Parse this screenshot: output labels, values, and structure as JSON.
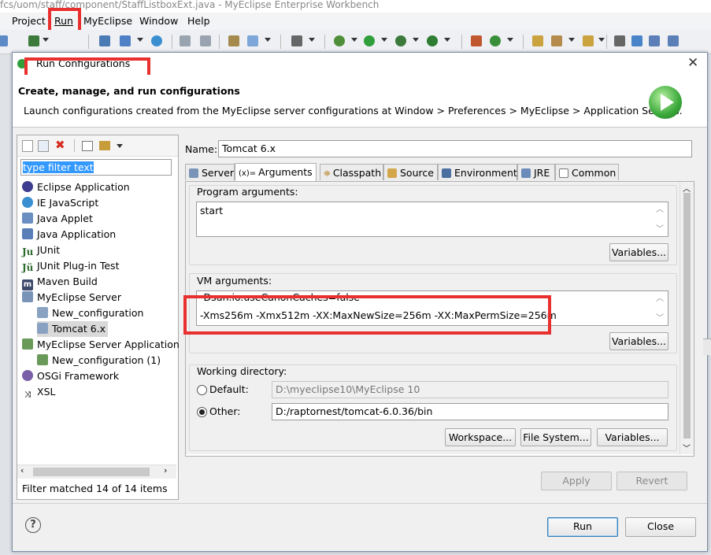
{
  "window": {
    "title": "fcs/uom/staff/component/StaffListboxExt.java - MyEclipse Enterprise Workbench"
  },
  "menubar": {
    "items": [
      "Project",
      "Run",
      "MyEclipse",
      "Window",
      "Help"
    ]
  },
  "dialog": {
    "title": "Run Configurations",
    "header_title": "Create, manage, and run configurations",
    "header_desc": "Launch configurations created from the MyEclipse server configurations at Window > Preferences > MyEclipse > Application Servers."
  },
  "filter": {
    "placeholder": "type filter text",
    "status": "Filter matched 14 of 14 items"
  },
  "tree": [
    {
      "label": "Eclipse Application",
      "icon": "eclipse-icon"
    },
    {
      "label": "IE JavaScript",
      "icon": "globe-icon"
    },
    {
      "label": "Java Applet",
      "icon": "applet-icon"
    },
    {
      "label": "Java Application",
      "icon": "java-app-icon"
    },
    {
      "label": "JUnit",
      "icon": "junit-icon"
    },
    {
      "label": "JUnit Plug-in Test",
      "icon": "junit-plugin-icon"
    },
    {
      "label": "Maven Build",
      "icon": "maven-icon"
    },
    {
      "label": "MyEclipse Server",
      "icon": "server-icon"
    },
    {
      "label": "New_configuration",
      "icon": "server-config-icon"
    },
    {
      "label": "Tomcat  6.x",
      "icon": "server-config-icon"
    },
    {
      "label": "MyEclipse Server Application",
      "icon": "server-app-icon"
    },
    {
      "label": "New_configuration (1)",
      "icon": "server-config-icon"
    },
    {
      "label": "OSGi Framework",
      "icon": "osgi-icon"
    },
    {
      "label": "XSL",
      "icon": "xsl-icon"
    }
  ],
  "config": {
    "name_label": "Name:",
    "name_value": "Tomcat  6.x",
    "tabs": [
      "Server",
      "Arguments",
      "Classpath",
      "Source",
      "Environment",
      "JRE",
      "Common"
    ],
    "selected_tab": "Arguments",
    "program_args_label": "Program arguments:",
    "program_args_value": "start",
    "vm_args_label": "VM arguments:",
    "vm_args_line1": "-Dsun.io.useCanonCaches=false",
    "vm_args_line2": "-Xms256m -Xmx512m -XX:MaxNewSize=256m -XX:MaxPermSize=256m",
    "variables_label": "Variables...",
    "working_dir_label": "Working directory:",
    "default_label": "Default:",
    "default_value": "D:\\myeclipse10\\MyEclipse 10",
    "other_label": "Other:",
    "other_value": "D:/raptornest/tomcat-6.0.36/bin",
    "workspace_label": "Workspace...",
    "filesystem_label": "File System..."
  },
  "buttons": {
    "apply": "Apply",
    "revert": "Revert",
    "run": "Run",
    "close": "Close",
    "help": "?"
  },
  "colors": {
    "highlight_red": "#e8302e",
    "selection": "#cde8ff"
  }
}
